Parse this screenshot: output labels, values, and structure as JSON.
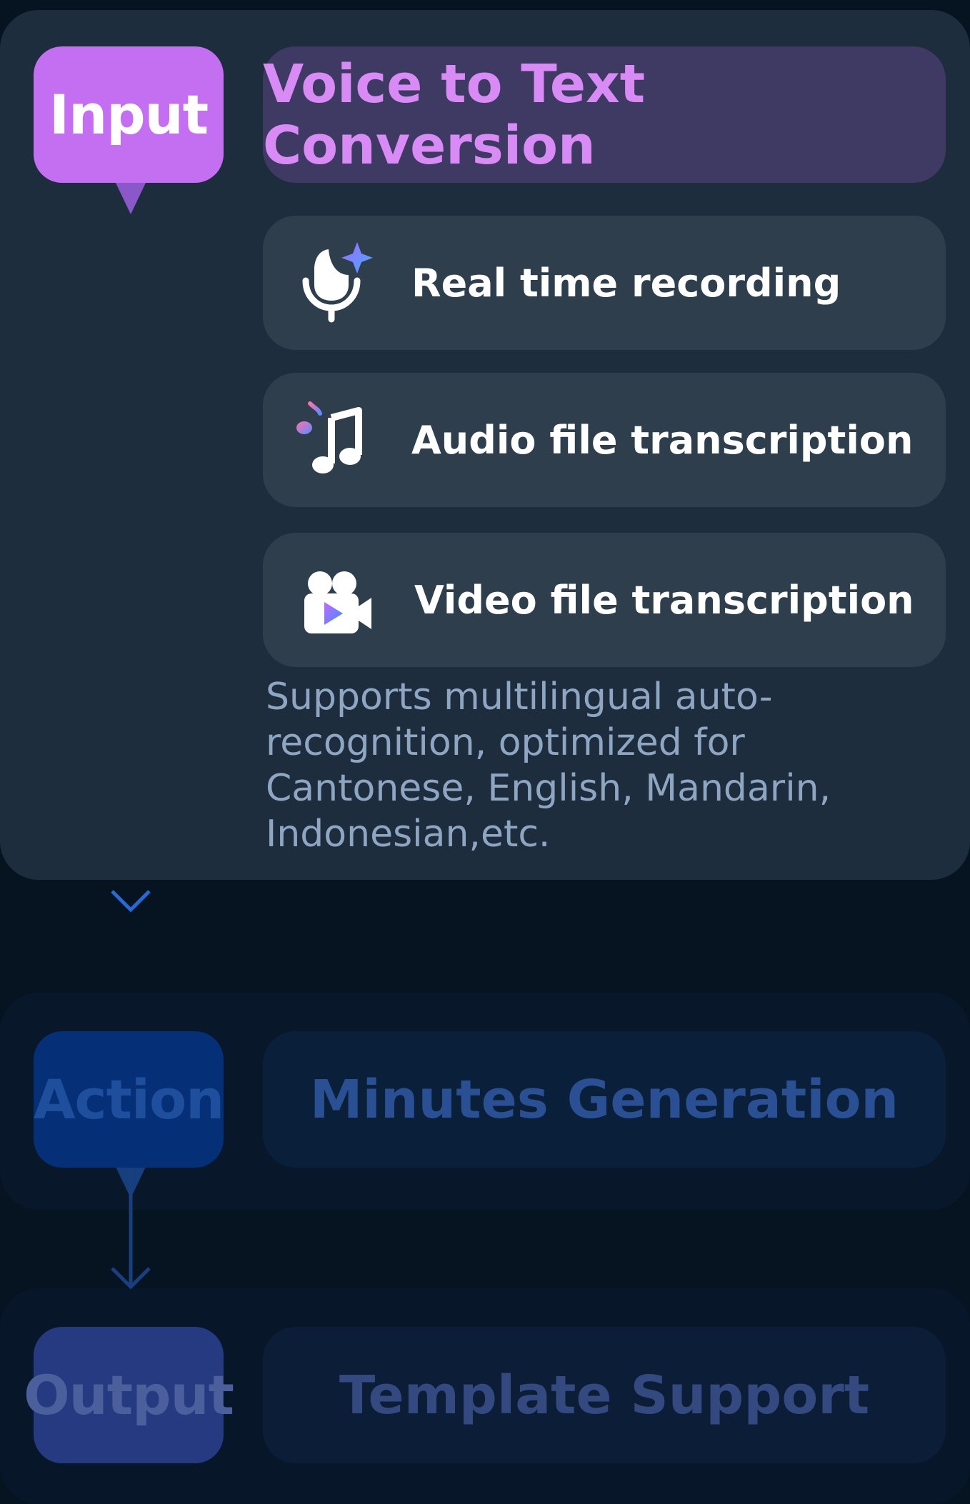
{
  "input": {
    "stage_label": "Input",
    "title": "Voice to Text Conversion",
    "features": [
      {
        "label": "Real time recording",
        "icon": "microphone-sparkle-icon"
      },
      {
        "label": "Audio file transcription",
        "icon": "music-note-icon"
      },
      {
        "label": "Video file transcription",
        "icon": "video-camera-icon"
      }
    ],
    "description": "Supports multilingual auto-recognition, optimized for Cantonese, English, Mandarin, Indonesian,etc."
  },
  "action": {
    "stage_label": "Action",
    "title": "Minutes Generation"
  },
  "output": {
    "stage_label": "Output",
    "title": "Template Support"
  },
  "colors": {
    "input_stage": "#c46ef2",
    "input_header_text": "#d88bf5",
    "action_stage": "#052f77",
    "output_stage": "#263a82"
  }
}
